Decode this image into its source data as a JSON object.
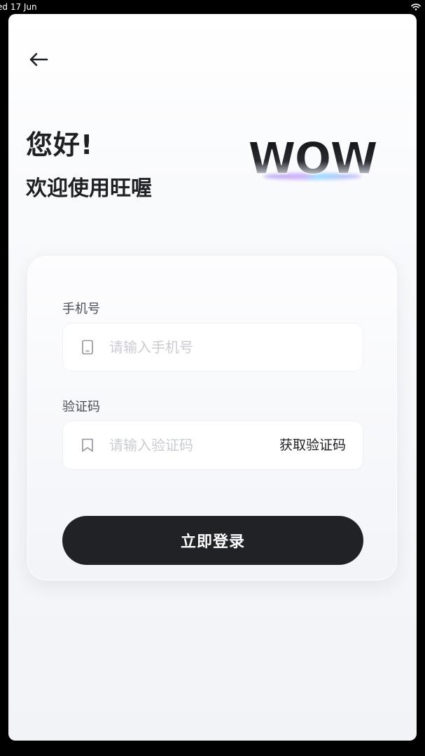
{
  "status_bar": {
    "time": "ed 17 Jun",
    "wifi_icon": "wifi-icon"
  },
  "header": {
    "back_icon": "arrow-left-icon",
    "greeting": "您好!",
    "welcome": "欢迎使用旺喔",
    "logo_text": "WOW"
  },
  "form": {
    "phone": {
      "label": "手机号",
      "placeholder": "请输入手机号",
      "value": "",
      "icon": "phone-icon"
    },
    "code": {
      "label": "验证码",
      "placeholder": "请输入验证码",
      "value": "",
      "icon": "bookmark-icon",
      "get_code_label": "获取验证码"
    },
    "submit_label": "立即登录"
  },
  "colors": {
    "primary_button": "#212226",
    "text_dark": "#1f2024",
    "placeholder": "#c9ccd2",
    "logo_accent_purple": "#a77bf0",
    "logo_accent_blue": "#5cc8ff"
  }
}
